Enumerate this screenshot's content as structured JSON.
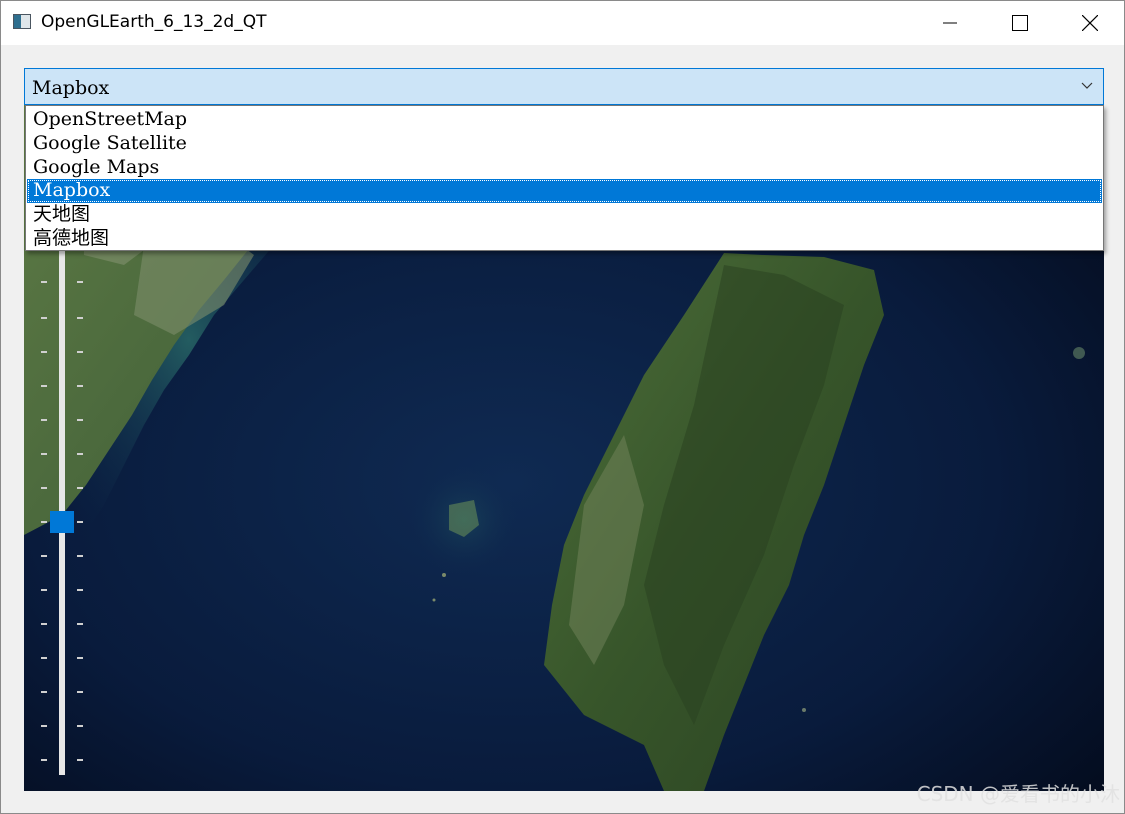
{
  "window": {
    "title": "OpenGLEarth_6_13_2d_QT",
    "icon": "app-window-icon",
    "controls": [
      "minimize-icon",
      "maximize-icon",
      "close-icon"
    ]
  },
  "combo": {
    "selected": "Mapbox",
    "arrow_icon": "chevron-down-icon",
    "options": [
      {
        "label": "OpenStreetMap",
        "selected": false
      },
      {
        "label": "Google Satellite",
        "selected": false
      },
      {
        "label": "Google Maps",
        "selected": false
      },
      {
        "label": "Mapbox",
        "selected": true
      },
      {
        "label": "天地图",
        "selected": false
      },
      {
        "label": "高德地图",
        "selected": false
      }
    ]
  },
  "map": {
    "type": "satellite imagery",
    "zoom_slider_level": 0.5
  },
  "watermark": "CSDN @爱看书的小沐",
  "colors": {
    "accent": "#0078d7",
    "combo_bg": "#cce4f7",
    "ocean": "#07142e",
    "land": "#3a5a2a"
  }
}
